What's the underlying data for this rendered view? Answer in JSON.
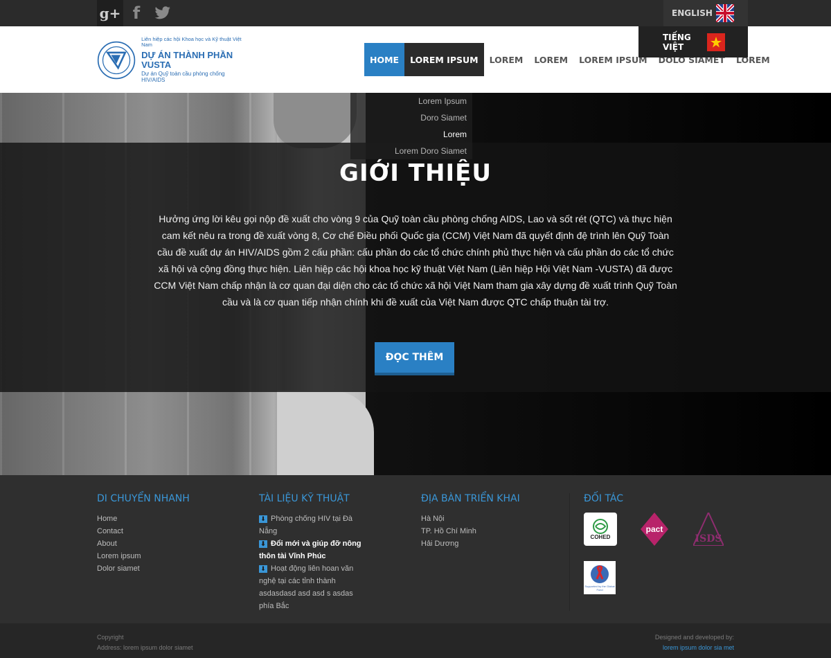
{
  "top_bar": {
    "social": [
      {
        "name": "google-plus",
        "glyph": "g+"
      },
      {
        "name": "facebook",
        "glyph": "f"
      },
      {
        "name": "twitter",
        "glyph": "🐦"
      }
    ],
    "languages": [
      {
        "label": "ENGLISH",
        "flag": "uk-flag"
      },
      {
        "label": "TIẾNG VIỆT",
        "flag": "vietnam-flag"
      }
    ]
  },
  "logo": {
    "small_line": "Liên hiệp các hội Khoa học và Kỹ thuật Việt Nam",
    "title": "DỰ ÁN THÀNH PHẦN VUSTA",
    "subtitle": "Dự án Quỹ toàn cầu phòng chống HIV/AIDS"
  },
  "nav": {
    "items": [
      "HOME",
      "LOREM IPSUM",
      "LOREM",
      "LOREM",
      "LOREM IPSUM",
      "DOLO SIAMET",
      "LOREM"
    ]
  },
  "dropdown": {
    "items": [
      "Lorem Ipsum",
      "Doro Siamet",
      "Lorem",
      "Lorem Doro Siamet"
    ]
  },
  "hero": {
    "title": "GIỚI THIỆU",
    "text": "Hưởng ứng lời kêu gọi nộp đề xuất cho vòng 9 của Quỹ toàn cầu phòng chống AIDS, Lao và sốt rét (QTC) và thực hiện cam kết nêu ra trong đề xuất vòng 8, Cơ chế Điều phối Quốc gia (CCM) Việt Nam đã quyết định đệ trình lên Quỹ Toàn cầu đề xuất dự án HIV/AIDS gồm 2 cấu phần: cấu phần do các tổ chức chính phủ thực hiện và cấu phần do các tổ chức xã hội và cộng đồng thực hiện. Liên hiệp các hội khoa học kỹ thuật Việt Nam (Liên hiệp Hội Việt Nam -VUSTA) đã được CCM Việt Nam chấp nhận là cơ quan đại diện cho các tổ chức xã hội Việt Nam tham gia xây dựng đề xuất trình Quỹ Toàn cầu và là cơ quan tiếp nhận chính khi đề xuất của Việt Nam được QTC chấp thuận tài trợ.",
    "button": "ĐỌC THÊM"
  },
  "footer": {
    "quick_nav": {
      "title": "DI CHUYỂN NHANH",
      "links": [
        "Home",
        "Contact",
        "About",
        "Lorem ipsum",
        "Dolor siamet"
      ]
    },
    "documents": {
      "title": "TÀI LIỆU KỸ THUẬT",
      "items": [
        "Phòng chống HIV tại Đà Nẵng",
        "Đổi mới và giúp đỡ nông thôn tài Vĩnh Phúc",
        "Hoạt động liên hoan văn nghệ tại các tỉnh thành asdasdasd asd asd s asdas phía Bắc"
      ]
    },
    "areas": {
      "title": "ĐỊA BÀN TRIỂN KHAI",
      "links": [
        "Hà Nội",
        "TP. Hồ Chí Minh",
        "Hải Dương"
      ]
    },
    "partners": {
      "title": "ĐỐI TÁC",
      "logos": [
        "COHED",
        "pact",
        "ISDS",
        "Supported by the Global Fund"
      ]
    }
  },
  "bottom": {
    "copyright": "Copyright",
    "address": "Address: lorem ipsum dolor siamet",
    "designed_by": "Designed and developed by:",
    "developer": "lorem ipsum dolor sia met"
  },
  "colors": {
    "accent": "#2a80c4",
    "footer_title": "#3a97d8",
    "dark_bg": "#2f2f2f"
  }
}
